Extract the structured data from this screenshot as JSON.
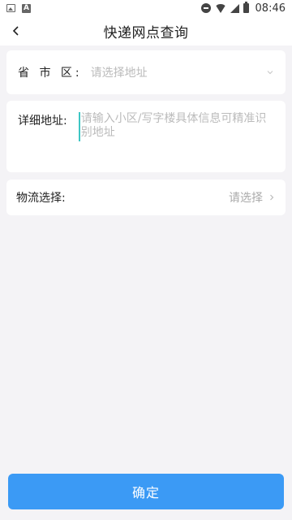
{
  "status_bar": {
    "time": "08:46",
    "icons": [
      "image-icon",
      "a-icon",
      "dnd-icon",
      "wifi-icon",
      "signal-icon",
      "battery-icon"
    ]
  },
  "header": {
    "title": "快递网点查询",
    "back_icon": "chevron-left-icon"
  },
  "form": {
    "region": {
      "label": "省 市 区:",
      "placeholder": "请选择地址",
      "icon": "chevron-down-icon"
    },
    "detail": {
      "label": "详细地址:",
      "placeholder": "请输入小区/写字楼具体信息可精准识别地址"
    },
    "logistics": {
      "label": "物流选择:",
      "value": "请选择",
      "icon": "chevron-right-icon"
    }
  },
  "footer": {
    "confirm_label": "确定"
  },
  "colors": {
    "accent": "#3b9af5",
    "background": "#f4f3f6",
    "caret": "#3ec6c4"
  }
}
